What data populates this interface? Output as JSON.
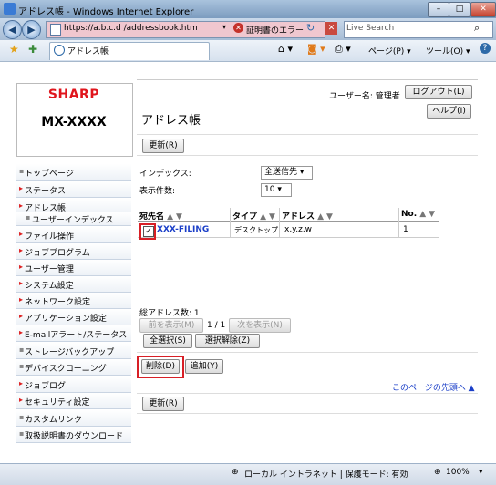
{
  "window": {
    "title": "アドレス帳         - Windows Internet Explorer",
    "min_glyph": "–",
    "max_glyph": "□",
    "close_glyph": "✕"
  },
  "navbar": {
    "back_glyph": "◀",
    "forward_glyph": "▶",
    "address": "https://a.b.c.d /addressbook.htm",
    "address_dropdown": "▾",
    "cert_glyph": "✕",
    "cert_error": "証明書のエラー",
    "refresh_glyph": "↻",
    "stop_glyph": "✕",
    "search_placeholder": "Live Search",
    "search_glyph": "⌕"
  },
  "favbar": {
    "tab_label": "アドレス帳",
    "page_menu": "ページ(P) ▾",
    "tools_menu": "ツール(O) ▾",
    "help_glyph": "?"
  },
  "logo": {
    "brand": "SHARP",
    "model": "MX-XXXX"
  },
  "header": {
    "user_label": "ユーザー名: 管理者",
    "logout": "ログアウト(L)",
    "help": "ヘルプ(I)",
    "page_title": "アドレス帳"
  },
  "menu": [
    {
      "label": "トップページ",
      "marker": "▪"
    },
    {
      "label": "ステータス",
      "marker": "▸"
    },
    {
      "label": "アドレス帳",
      "marker": "▸"
    },
    {
      "label": "ユーザーインデックス",
      "marker": "▪"
    },
    {
      "label": "ファイル操作",
      "marker": "▸"
    },
    {
      "label": "ジョブプログラム",
      "marker": "▸"
    },
    {
      "label": "ユーザー管理",
      "marker": "▸"
    },
    {
      "label": "システム設定",
      "marker": "▸"
    },
    {
      "label": "ネットワーク設定",
      "marker": "▸"
    },
    {
      "label": "アプリケーション設定",
      "marker": "▸"
    },
    {
      "label": "E-mailアラート/ステータス",
      "marker": "▸"
    },
    {
      "label": "ストレージバックアップ",
      "marker": "▪"
    },
    {
      "label": "デバイスクローニング",
      "marker": "▪"
    },
    {
      "label": "ジョブログ",
      "marker": "▸"
    },
    {
      "label": "セキュリティ設定",
      "marker": "▸"
    },
    {
      "label": "カスタムリンク",
      "marker": "▪"
    },
    {
      "label": "取扱説明書のダウンロード",
      "marker": "▪"
    }
  ],
  "main": {
    "update_button": "更新(R)",
    "index_label": "インデックス:",
    "index_value": "全送信先 ▾",
    "count_label": "表示件数:",
    "count_value": "10 ▾",
    "columns": [
      {
        "label": "宛先名",
        "sort": "▲ ▼"
      },
      {
        "label": "タイプ",
        "sort": "▲ ▼"
      },
      {
        "label": "アドレス",
        "sort": "▲ ▼"
      },
      {
        "label": "No.",
        "sort": "▲ ▼"
      }
    ],
    "rows": [
      {
        "checked": "✓",
        "name": "XXX-FILING",
        "type": "デスクトップ",
        "address": "x.y.z.w",
        "no": "1"
      }
    ],
    "total_label": "総アドレス数: 1",
    "prev_button": "前を表示(M)",
    "page_indicator": "1 / 1",
    "next_button": "次を表示(N)",
    "select_all": "全選択(S)",
    "deselect_all": "選択解除(Z)",
    "delete_button": "削除(D)",
    "add_button": "追加(Y)",
    "top_link": "このページの先頭へ ▲",
    "update_button_bottom": "更新(R)"
  },
  "statusbar": {
    "zone": "ローカル イントラネット | 保護モード: 有効",
    "zoom": "100%"
  },
  "colors": {
    "brand_red": "#e0161d",
    "link_blue": "#1a3ec8",
    "highlight": "#d81f26"
  }
}
